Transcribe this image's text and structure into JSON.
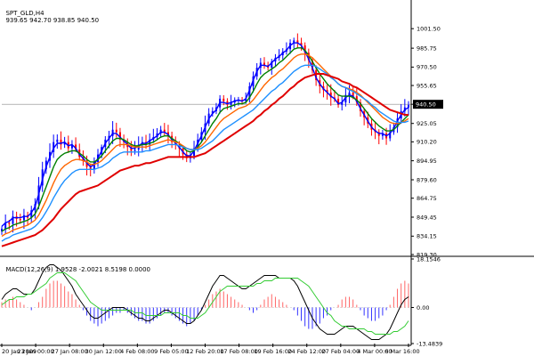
{
  "header": {
    "symbol": "SPT_GLD,H4",
    "ohlc": "939.65 942.70 938.85 940.50"
  },
  "macd_header": {
    "label": "MACD(12,26,9) 1.9528 -2.0021 8.5198 0.0000"
  },
  "colors": {
    "background": "#ffffff",
    "bull_candle": "#0000ff",
    "bear_candle": "#ff0000",
    "ma_blue": "#0000ff",
    "ma_green": "#008000",
    "ma_orange": "#ff6600",
    "ma_lightblue": "#1e90ff",
    "ma_red": "#e00000",
    "macd_main": "#000000",
    "macd_signal": "#33cc33",
    "macd_hist_pos": "#ff6666",
    "macd_hist_neg": "#3333ff",
    "current_price_bg": "#000000",
    "current_price_fg": "#ffffff"
  },
  "chart_data": [
    {
      "type": "candlestick",
      "title": "SPT_GLD,H4",
      "ylim": [
        819.3,
        1016.0
      ],
      "y_ticks": [
        "1001.50",
        "985.75",
        "970.50",
        "955.65",
        "940.50",
        "925.05",
        "910.20",
        "894.95",
        "879.60",
        "864.75",
        "849.45",
        "834.15",
        "819.30"
      ],
      "current_price": "940.50",
      "x_ticks": [
        "20 Jan 2009",
        "23 Jan 00:00",
        "27 Jan 08:00",
        "30 Jan 12:00",
        "4 Feb 08:00",
        "9 Feb 05:00",
        "12 Feb 20:00",
        "17 Feb 08:00",
        "19 Feb 16:00",
        "24 Feb 12:00",
        "27 Feb 04:00",
        "4 Mar 00:00",
        "6 Mar 16:00"
      ],
      "close": [
        840,
        845,
        844,
        850,
        848,
        847,
        851,
        849,
        855,
        860,
        875,
        888,
        895,
        902,
        910,
        912,
        908,
        910,
        905,
        908,
        904,
        898,
        895,
        890,
        888,
        894,
        900,
        906,
        912,
        915,
        920,
        918,
        912,
        910,
        906,
        903,
        904,
        908,
        910,
        908,
        912,
        914,
        917,
        920,
        918,
        915,
        910,
        908,
        905,
        900,
        897,
        899,
        905,
        912,
        918,
        925,
        933,
        935,
        938,
        945,
        943,
        940,
        942,
        944,
        944,
        943,
        945,
        955,
        963,
        970,
        974,
        972,
        970,
        975,
        978,
        980,
        983,
        985,
        990,
        992,
        990,
        988,
        982,
        976,
        968,
        960,
        955,
        952,
        950,
        946,
        945,
        940,
        942,
        948,
        950,
        947,
        942,
        935,
        930,
        925,
        920,
        918,
        915,
        917,
        913,
        918,
        922,
        929,
        935,
        938,
        940
      ],
      "series": [
        {
          "name": "",
          "color": "#0000ff",
          "values": [
            842,
            845,
            846,
            849,
            849,
            849,
            850,
            850,
            853,
            858,
            868,
            880,
            890,
            898,
            905,
            909,
            909,
            910,
            907,
            908,
            905,
            900,
            897,
            893,
            890,
            892,
            897,
            903,
            909,
            913,
            917,
            917,
            914,
            911,
            908,
            905,
            905,
            907,
            909,
            909,
            911,
            913,
            915,
            918,
            918,
            916,
            912,
            909,
            906,
            902,
            899,
            899,
            903,
            909,
            915,
            922,
            929,
            933,
            936,
            942,
            942,
            941,
            942,
            943,
            944,
            943,
            945,
            952,
            960,
            967,
            972,
            972,
            971,
            974,
            977,
            979,
            982,
            984,
            988,
            990,
            990,
            988,
            983,
            977,
            970,
            962,
            957,
            953,
            950,
            947,
            945,
            941,
            942,
            946,
            948,
            947,
            943,
            937,
            932,
            927,
            922,
            919,
            917,
            917,
            915,
            917,
            921,
            927,
            932,
            936,
            938
          ]
        },
        {
          "name": "",
          "color": "#008000",
          "values": [
            838,
            840,
            841,
            843,
            844,
            845,
            846,
            847,
            849,
            852,
            858,
            866,
            874,
            882,
            890,
            896,
            899,
            901,
            902,
            903,
            903,
            901,
            899,
            896,
            894,
            894,
            896,
            899,
            903,
            907,
            911,
            913,
            913,
            912,
            910,
            908,
            907,
            907,
            908,
            908,
            909,
            910,
            912,
            914,
            915,
            915,
            913,
            911,
            909,
            906,
            903,
            902,
            903,
            906,
            910,
            915,
            920,
            925,
            929,
            934,
            937,
            938,
            939,
            940,
            941,
            941,
            942,
            946,
            951,
            957,
            962,
            965,
            967,
            969,
            971,
            974,
            976,
            979,
            982,
            985,
            986,
            986,
            984,
            980,
            975,
            970,
            965,
            961,
            957,
            954,
            951,
            948,
            947,
            947,
            947,
            946,
            944,
            941,
            937,
            933,
            929,
            926,
            923,
            921,
            919,
            919,
            920,
            923,
            926,
            929,
            932
          ]
        },
        {
          "name": "",
          "color": "#ff6600",
          "values": [
            834,
            836,
            837,
            839,
            840,
            841,
            842,
            843,
            845,
            847,
            851,
            857,
            863,
            870,
            877,
            883,
            888,
            891,
            893,
            895,
            896,
            896,
            895,
            894,
            892,
            892,
            893,
            895,
            898,
            901,
            904,
            907,
            908,
            908,
            908,
            907,
            906,
            906,
            906,
            906,
            907,
            908,
            909,
            910,
            911,
            912,
            911,
            910,
            909,
            907,
            905,
            904,
            904,
            905,
            907,
            910,
            914,
            918,
            922,
            926,
            929,
            931,
            933,
            935,
            937,
            938,
            939,
            941,
            944,
            948,
            952,
            956,
            959,
            962,
            964,
            967,
            969,
            972,
            975,
            978,
            980,
            981,
            981,
            980,
            978,
            975,
            972,
            969,
            966,
            963,
            960,
            957,
            955,
            954,
            953,
            952,
            950,
            948,
            945,
            942,
            939,
            936,
            933,
            930,
            928,
            926,
            925,
            925,
            926,
            927,
            929
          ]
        },
        {
          "name": "",
          "color": "#1e90ff",
          "values": [
            830,
            832,
            833,
            835,
            836,
            837,
            838,
            839,
            840,
            842,
            845,
            849,
            854,
            859,
            865,
            870,
            875,
            879,
            882,
            885,
            887,
            888,
            888,
            888,
            888,
            888,
            889,
            890,
            892,
            894,
            897,
            899,
            901,
            902,
            902,
            902,
            902,
            902,
            902,
            903,
            903,
            904,
            905,
            906,
            907,
            908,
            908,
            908,
            907,
            906,
            905,
            904,
            904,
            904,
            905,
            907,
            909,
            911,
            914,
            917,
            920,
            922,
            924,
            926,
            928,
            930,
            932,
            934,
            936,
            939,
            942,
            945,
            948,
            951,
            953,
            956,
            958,
            961,
            964,
            967,
            969,
            971,
            972,
            972,
            972,
            971,
            969,
            967,
            965,
            962,
            960,
            957,
            955,
            954,
            952,
            951,
            949,
            947,
            945,
            943,
            940,
            938,
            935,
            933,
            931,
            929,
            927,
            926,
            926,
            926,
            927
          ]
        },
        {
          "name": "",
          "color": "#e00000",
          "values": [
            826,
            827,
            828,
            829,
            830,
            831,
            832,
            833,
            834,
            835,
            837,
            839,
            842,
            845,
            848,
            852,
            856,
            859,
            862,
            865,
            868,
            870,
            871,
            872,
            873,
            874,
            875,
            877,
            879,
            881,
            883,
            885,
            887,
            888,
            889,
            890,
            891,
            891,
            892,
            893,
            893,
            894,
            895,
            896,
            897,
            898,
            898,
            898,
            898,
            898,
            898,
            898,
            898,
            899,
            900,
            901,
            903,
            905,
            907,
            909,
            911,
            913,
            915,
            917,
            919,
            921,
            923,
            925,
            927,
            930,
            932,
            935,
            937,
            940,
            942,
            945,
            947,
            950,
            953,
            955,
            958,
            960,
            962,
            963,
            964,
            965,
            965,
            965,
            964,
            963,
            962,
            961,
            959,
            958,
            957,
            955,
            954,
            952,
            950,
            948,
            946,
            944,
            942,
            940,
            938,
            936,
            935,
            934,
            933,
            932,
            932
          ]
        }
      ]
    },
    {
      "type": "bar",
      "title": "MACD(12,26,9) 1.9528 -2.0021 8.5198 0.0000",
      "ylim": [
        -13.4839,
        18.1546
      ],
      "y_ticks": [
        "18.1546",
        "0.00",
        "-13.4839"
      ],
      "histogram": [
        2,
        3,
        3,
        4,
        3,
        2,
        1,
        0,
        -1,
        0,
        2,
        4,
        7,
        9,
        10,
        10,
        9,
        8,
        6,
        5,
        3,
        1,
        -1,
        -3,
        -5,
        -6,
        -7,
        -6,
        -5,
        -4,
        -3,
        -2,
        -2,
        -1,
        -2,
        -3,
        -4,
        -5,
        -5,
        -6,
        -6,
        -5,
        -4,
        -3,
        -2,
        -2,
        -3,
        -4,
        -5,
        -6,
        -7,
        -6,
        -5,
        -3,
        -1,
        1,
        3,
        5,
        6,
        7,
        6,
        5,
        4,
        3,
        2,
        1,
        0,
        -1,
        -2,
        -1,
        1,
        3,
        4,
        5,
        4,
        3,
        2,
        1,
        0,
        -1,
        -3,
        -5,
        -7,
        -8,
        -8,
        -7,
        -6,
        -4,
        -3,
        -1,
        0,
        1,
        3,
        4,
        4,
        3,
        1,
        -1,
        -3,
        -4,
        -5,
        -5,
        -4,
        -3,
        -1,
        1,
        4,
        7,
        9,
        10,
        9
      ],
      "series": [
        {
          "name": "",
          "color": "#000000",
          "values": [
            3,
            5,
            6,
            7,
            7,
            6,
            5,
            5,
            5,
            7,
            10,
            13,
            15,
            16,
            16,
            15,
            14,
            12,
            10,
            8,
            5,
            3,
            1,
            -1,
            -3,
            -4,
            -4,
            -3,
            -2,
            -1,
            0,
            0,
            0,
            0,
            -1,
            -2,
            -3,
            -4,
            -4,
            -5,
            -5,
            -4,
            -3,
            -2,
            -1,
            -1,
            -2,
            -3,
            -4,
            -5,
            -6,
            -6,
            -5,
            -3,
            -1,
            2,
            5,
            8,
            10,
            12,
            12,
            11,
            10,
            9,
            8,
            7,
            7,
            8,
            9,
            10,
            11,
            12,
            12,
            12,
            12,
            11,
            11,
            11,
            11,
            10,
            8,
            5,
            2,
            -1,
            -4,
            -6,
            -8,
            -9,
            -10,
            -10,
            -10,
            -9,
            -8,
            -7,
            -7,
            -7,
            -8,
            -9,
            -10,
            -11,
            -12,
            -12,
            -12,
            -11,
            -10,
            -8,
            -5,
            -2,
            1,
            3,
            4
          ]
        },
        {
          "name": "",
          "color": "#33cc33",
          "values": [
            1,
            2,
            3,
            3,
            4,
            4,
            4,
            5,
            5,
            6,
            7,
            8,
            9,
            11,
            12,
            13,
            13,
            13,
            12,
            11,
            10,
            8,
            6,
            4,
            2,
            1,
            0,
            -1,
            -1,
            -1,
            -1,
            -1,
            -1,
            -1,
            -1,
            -1,
            -2,
            -2,
            -2,
            -3,
            -3,
            -3,
            -3,
            -3,
            -2,
            -2,
            -2,
            -2,
            -2,
            -3,
            -3,
            -4,
            -4,
            -4,
            -3,
            -2,
            0,
            2,
            4,
            6,
            7,
            8,
            8,
            8,
            8,
            8,
            8,
            8,
            8,
            9,
            9,
            10,
            10,
            10,
            11,
            11,
            11,
            11,
            11,
            11,
            11,
            10,
            9,
            8,
            6,
            4,
            2,
            0,
            -2,
            -3,
            -5,
            -6,
            -7,
            -7,
            -8,
            -8,
            -8,
            -8,
            -8,
            -9,
            -9,
            -10,
            -10,
            -10,
            -10,
            -10,
            -9,
            -9,
            -8,
            -7,
            -5
          ]
        }
      ]
    }
  ]
}
